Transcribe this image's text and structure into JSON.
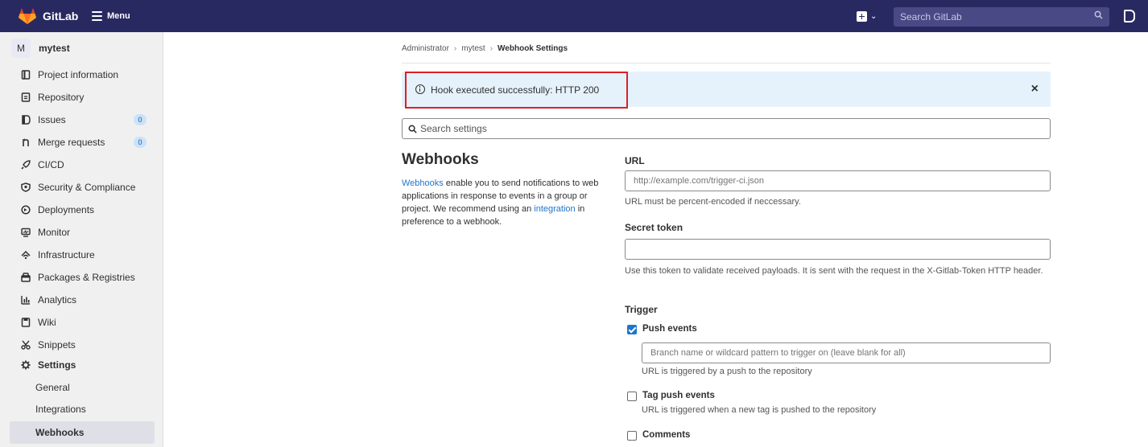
{
  "topbar": {
    "brand": "GitLab",
    "menu_label": "Menu",
    "search_placeholder": "Search GitLab"
  },
  "sidebar": {
    "project_initial": "M",
    "project_name": "mytest",
    "items": [
      {
        "label": "Project information",
        "icon": "info-doc-icon"
      },
      {
        "label": "Repository",
        "icon": "repository-icon"
      },
      {
        "label": "Issues",
        "icon": "issues-icon",
        "count": "0"
      },
      {
        "label": "Merge requests",
        "icon": "merge-request-icon",
        "count": "0"
      },
      {
        "label": "CI/CD",
        "icon": "rocket-icon"
      },
      {
        "label": "Security & Compliance",
        "icon": "shield-icon"
      },
      {
        "label": "Deployments",
        "icon": "deployments-icon"
      },
      {
        "label": "Monitor",
        "icon": "monitor-icon"
      },
      {
        "label": "Infrastructure",
        "icon": "cloud-icon"
      },
      {
        "label": "Packages & Registries",
        "icon": "package-icon"
      },
      {
        "label": "Analytics",
        "icon": "chart-icon"
      },
      {
        "label": "Wiki",
        "icon": "book-icon"
      },
      {
        "label": "Snippets",
        "icon": "scissors-icon"
      },
      {
        "label": "Settings",
        "icon": "gear-icon"
      },
      {
        "label": "General"
      },
      {
        "label": "Integrations"
      },
      {
        "label": "Webhooks"
      }
    ]
  },
  "breadcrumb": [
    "Administrator",
    "mytest",
    "Webhook Settings"
  ],
  "alert": {
    "text": "Hook executed successfully: HTTP 200",
    "close": "×"
  },
  "search_settings": {
    "placeholder": "Search settings"
  },
  "webhooks": {
    "title": "Webhooks",
    "desc_link1": "Webhooks",
    "desc_mid": " enable you to send notifications to web applications in response to events in a group or project. We recommend using an ",
    "desc_link2": "integration",
    "desc_end": " in preference to a webhook."
  },
  "form": {
    "url_label": "URL",
    "url_placeholder": "http://example.com/trigger-ci.json",
    "url_help": "URL must be percent-encoded if neccessary.",
    "secret_label": "Secret token",
    "secret_help": "Use this token to validate received payloads. It is sent with the request in the X-Gitlab-Token HTTP header.",
    "trigger_label": "Trigger",
    "push_events": {
      "label": "Push events",
      "checked": true,
      "placeholder": "Branch name or wildcard pattern to trigger on (leave blank for all)",
      "help": "URL is triggered by a push to the repository"
    },
    "tag_push_events": {
      "label": "Tag push events",
      "checked": false,
      "help": "URL is triggered when a new tag is pushed to the repository"
    },
    "comments": {
      "label": "Comments",
      "checked": false
    }
  }
}
